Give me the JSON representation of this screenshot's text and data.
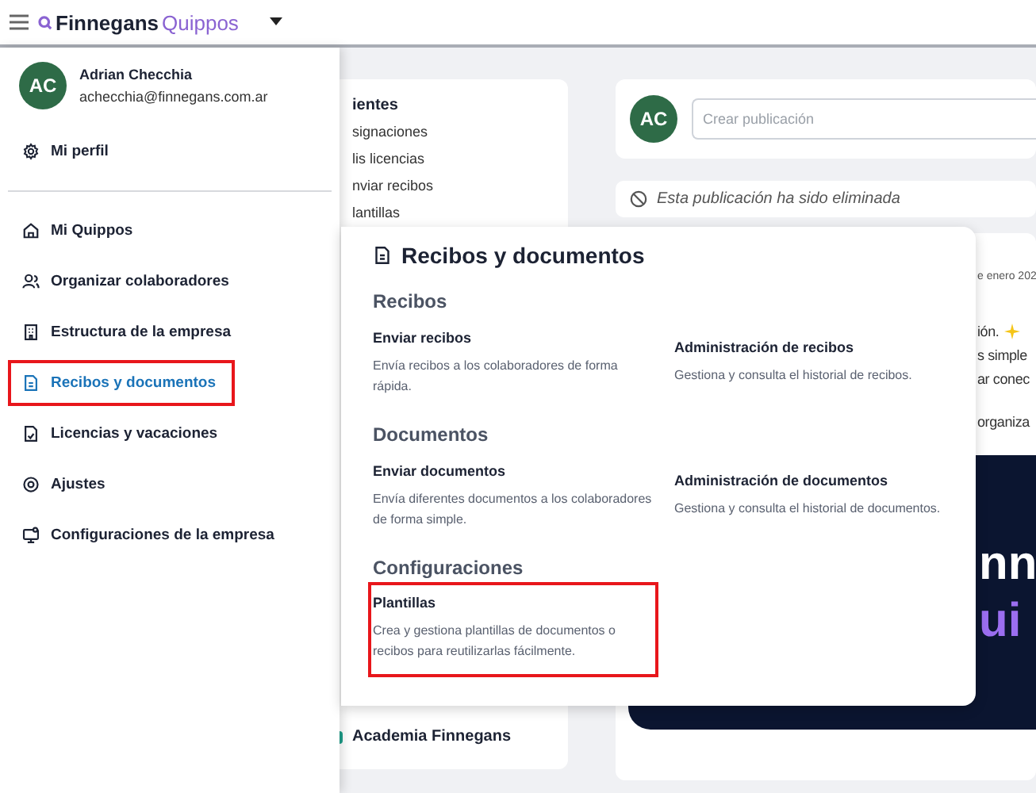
{
  "top_bar": {
    "brand_first": "Finnegans",
    "brand_second": "Quippos"
  },
  "user": {
    "initials": "AC",
    "name": "Adrian Checchia",
    "email": "achecchia@finnegans.com.ar"
  },
  "profile_link": {
    "label": "Mi perfil"
  },
  "menu": [
    {
      "label": "Mi Quippos",
      "kind": "home",
      "selected": false,
      "highlighted": false
    },
    {
      "label": "Organizar colaboradores",
      "kind": "people",
      "selected": false,
      "highlighted": false
    },
    {
      "label": "Estructura de la empresa",
      "kind": "building",
      "selected": false,
      "highlighted": false
    },
    {
      "label": "Recibos y documentos",
      "kind": "document",
      "selected": true,
      "highlighted": true
    },
    {
      "label": "Licencias y vacaciones",
      "kind": "calendar",
      "selected": false,
      "highlighted": false
    },
    {
      "label": "Ajustes",
      "kind": "settings",
      "selected": false,
      "highlighted": false
    },
    {
      "label": "Configuraciones de la empresa",
      "kind": "monitor",
      "selected": false,
      "highlighted": false
    }
  ],
  "left_card": {
    "title": "ientes",
    "links": [
      "signaciones",
      "lis licencias",
      "nviar recibos",
      "lantillas"
    ],
    "footer": "Academia Finnegans"
  },
  "post_box": {
    "initials": "AC",
    "placeholder": "Crear publicación"
  },
  "deleted_notice": "Esta publicación ha sido eliminada",
  "feed_post": {
    "date": "e enero 202",
    "lines": [
      "ión.",
      "s simple",
      "ar conec",
      "organiza"
    ],
    "banner_lines": [
      "nn",
      "ui"
    ]
  },
  "popup": {
    "title": "Recibos y documentos",
    "sections": [
      {
        "heading": "Recibos",
        "items": [
          {
            "title": "Enviar recibos",
            "description": "Envía recibos a los colaboradores de forma rápida.",
            "highlighted": false
          },
          {
            "title": "Administración de recibos",
            "description": "Gestiona y consulta el historial de recibos.",
            "highlighted": false
          }
        ]
      },
      {
        "heading": "Documentos",
        "items": [
          {
            "title": "Enviar documentos",
            "description": "Envía diferentes documentos a los colaboradores de forma simple.",
            "highlighted": false
          },
          {
            "title": "Administración de documentos",
            "description": "Gestiona y consulta el historial de documentos.",
            "highlighted": false
          }
        ]
      },
      {
        "heading": "Configuraciones",
        "items": [
          {
            "title": "Plantillas",
            "description": "Crea y gestiona plantillas de documentos o recibos para reutilizarlas fácilmente.",
            "highlighted": true
          }
        ]
      }
    ]
  }
}
